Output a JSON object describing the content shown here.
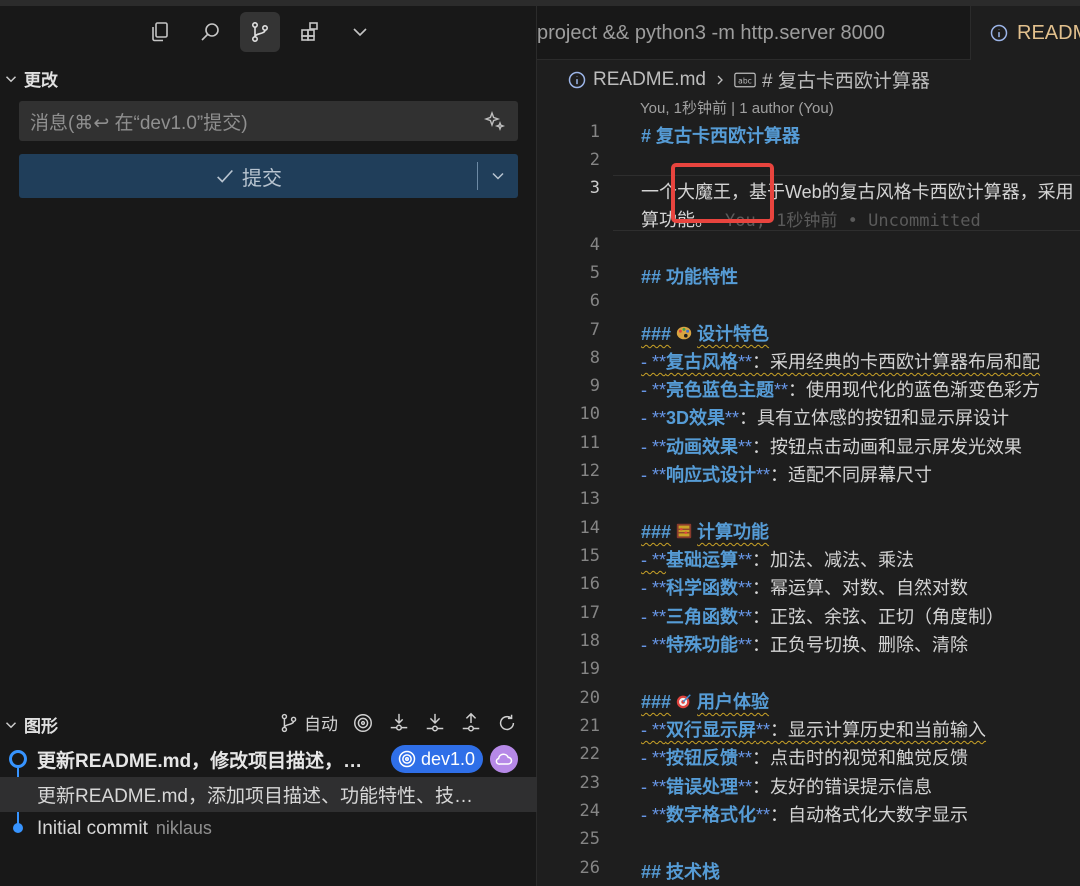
{
  "scm": {
    "changes_header": "更改",
    "message_placeholder": "消息(⌘↩ 在“dev1.0”提交)",
    "commit_label": "提交",
    "graph_header": "图形",
    "graph_auto_label": "自动",
    "commits": [
      {
        "message": "更新README.md，修改项目描述，…",
        "author": ""
      },
      {
        "message": "更新README.md，添加项目描述、功能特性、技…",
        "author": ""
      },
      {
        "message": "Initial commit",
        "author": "niklaus"
      }
    ],
    "branch_badge": "dev1.0"
  },
  "editor": {
    "terminal_tab": "project && python3 -m http.server 8000",
    "readme_tab": "READM",
    "breadcrumb": {
      "file": "README.md",
      "symbol": "# 复古卡西欧计算器"
    },
    "codelens": "You, 1秒钟前 | 1 author (You)",
    "blame": "You, 1秒钟前 • Uncommitted",
    "lines": {
      "l1": "# 复古卡西欧计算器",
      "l3a": "一个",
      "l3b": "大魔王，",
      "l3c": "基于Web的复古风格卡西欧计算器，采用",
      "l3d": "算功能。",
      "l5": "## 功能特性",
      "l7": "设计特色",
      "l8": "复古风格",
      "l8t": "：采用经典的卡西欧计算器布局和配",
      "l9": "亮色蓝色主题",
      "l9t": "：使用现代化的蓝色渐变色彩方",
      "l10": "3D效果",
      "l10t": "：具有立体感的按钮和显示屏设计",
      "l11": "动画效果",
      "l11t": "：按钮点击动画和显示屏发光效果",
      "l12": "响应式设计",
      "l12t": "：适配不同屏幕尺寸",
      "l14": "计算功能",
      "l15": "基础运算",
      "l15t": "：加法、减法、乘法",
      "l16": "科学函数",
      "l16t": "：幂运算、对数、自然对数",
      "l17": "三角函数",
      "l17t": "：正弦、余弦、正切（角度制）",
      "l18": "特殊功能",
      "l18t": "：正负号切换、删除、清除",
      "l20": "用户体验",
      "l21": "双行显示屏",
      "l21t": "：显示计算历史和当前输入",
      "l22": "按钮反馈",
      "l22t": "：点击时的视觉和触觉反馈",
      "l23": "错误处理",
      "l23t": "：友好的错误提示信息",
      "l24": "数字格式化",
      "l24t": "：自动格式化大数字显示",
      "l26": "## 技术栈"
    },
    "line_numbers": [
      "1",
      "2",
      "3",
      "4",
      "5",
      "6",
      "7",
      "8",
      "9",
      "10",
      "11",
      "12",
      "13",
      "14",
      "15",
      "16",
      "17",
      "18",
      "19",
      "20",
      "21",
      "22",
      "23",
      "24",
      "25",
      "26"
    ]
  },
  "colors": {
    "heading": "#569cd6",
    "highlight_box": "#e8443e",
    "branch_badge": "#2f6fe8",
    "commit_button": "#203e5a"
  }
}
